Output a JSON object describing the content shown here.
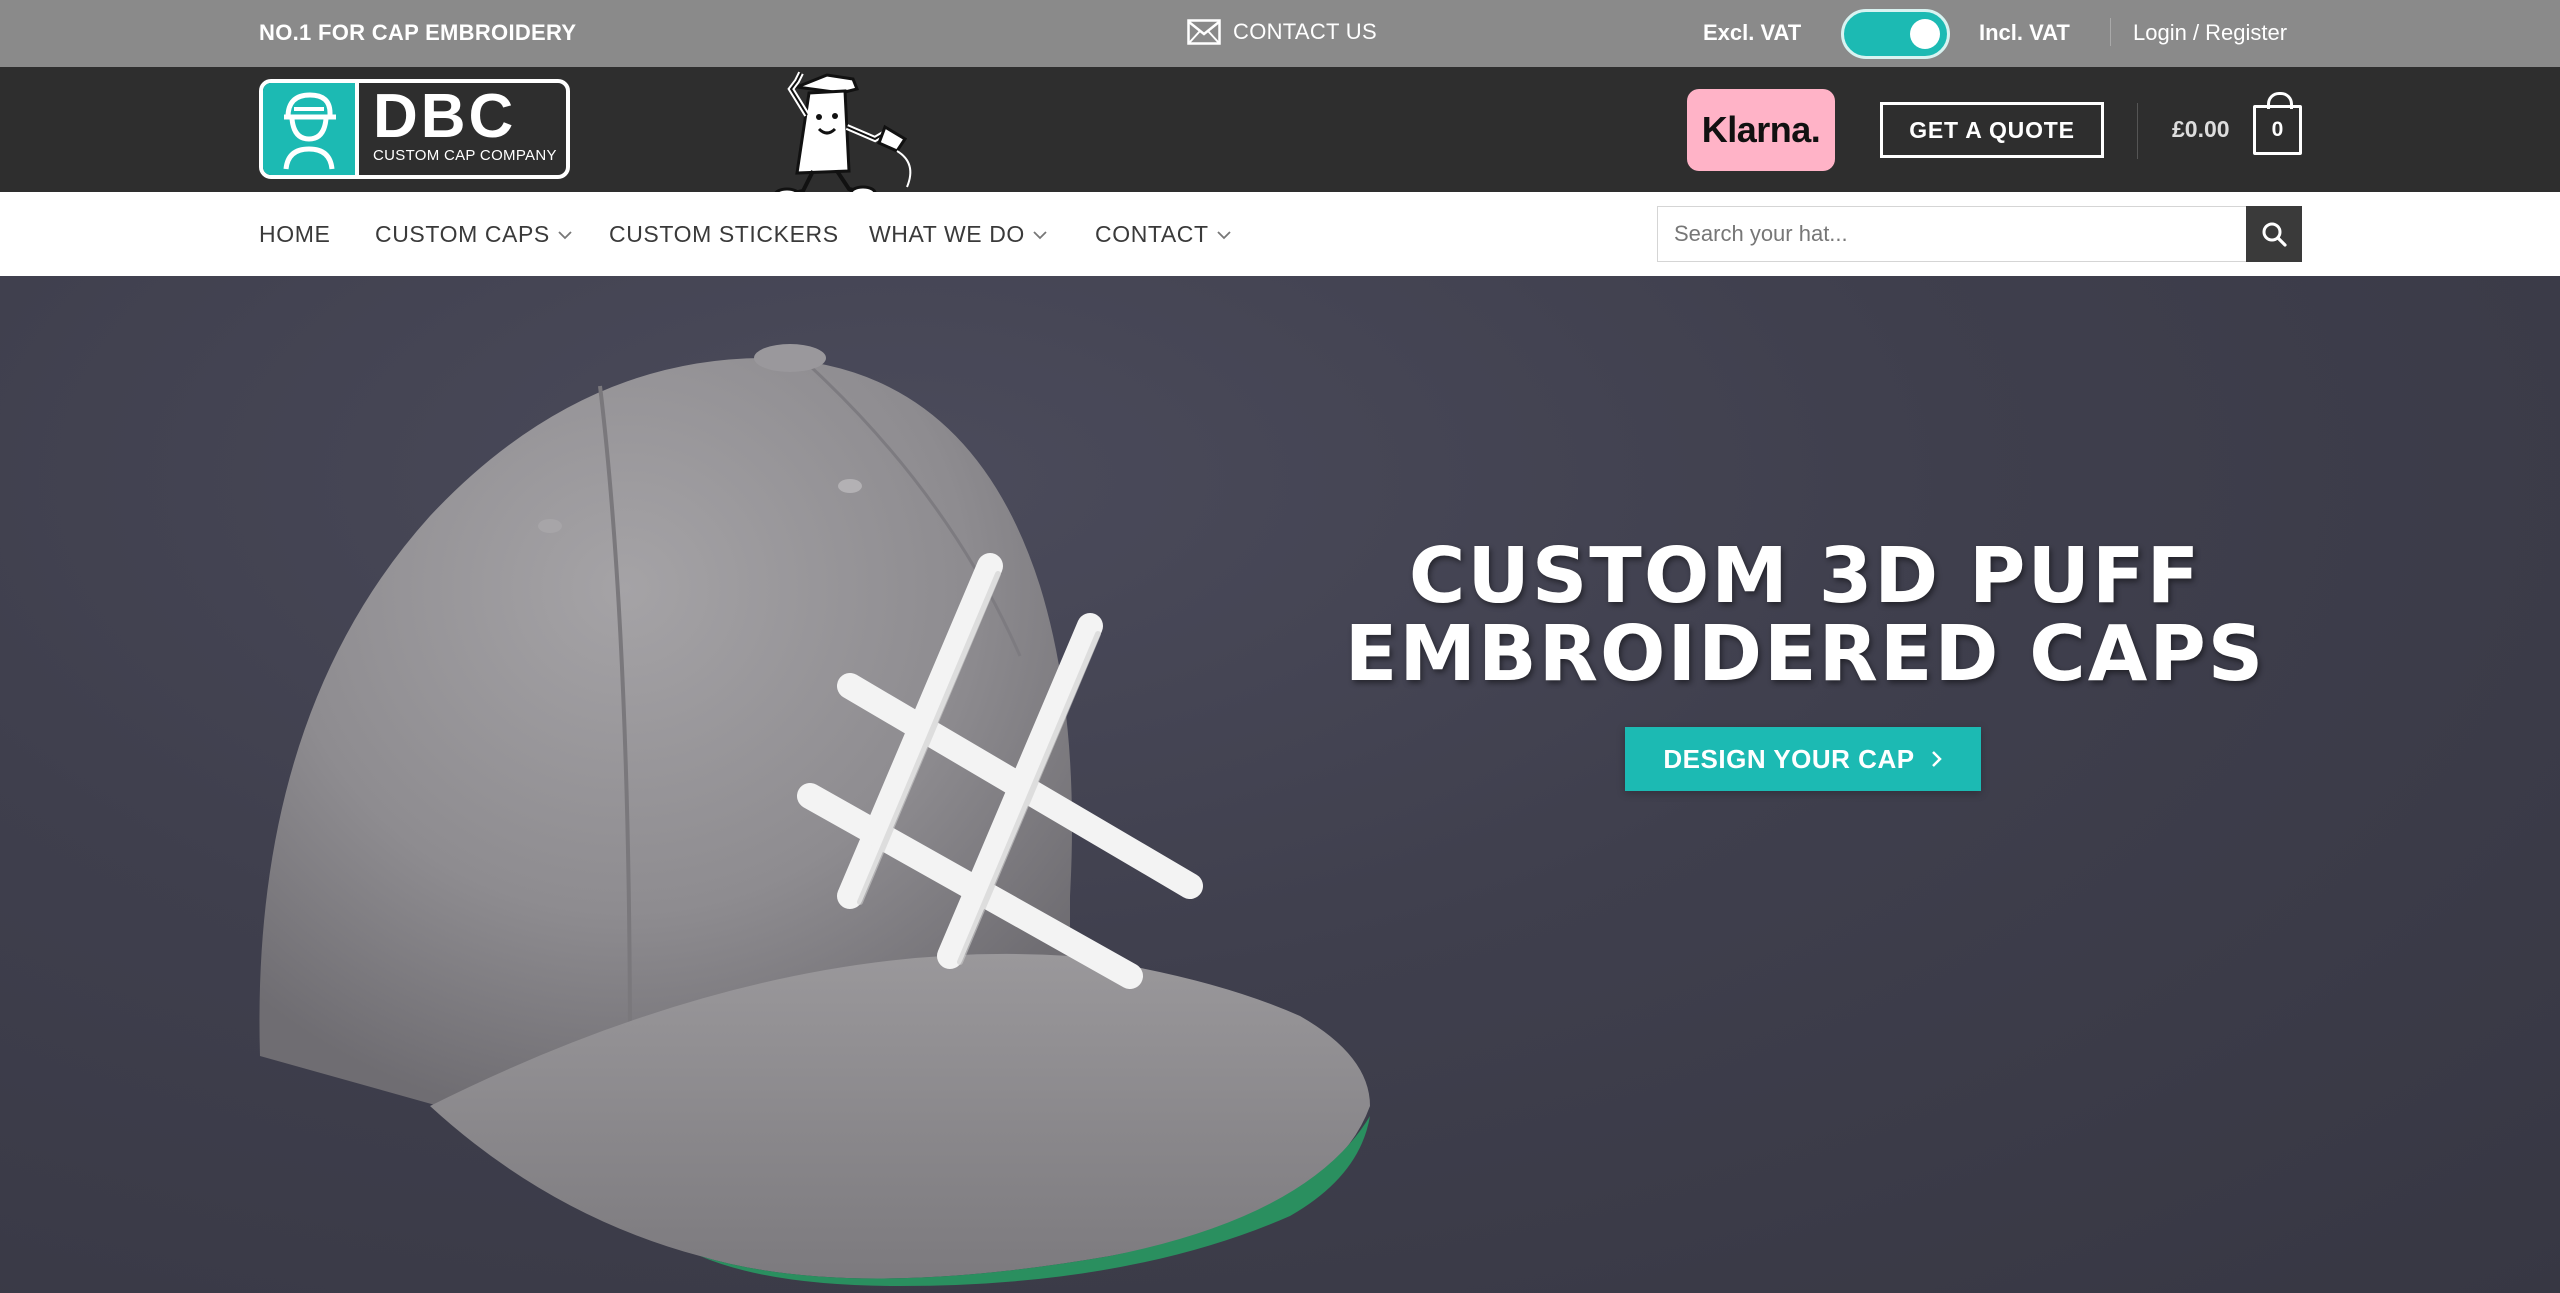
{
  "topbar": {
    "tagline": "NO.1 FOR CAP EMBROIDERY",
    "contact_label": "CONTACT US",
    "vat_excl_label": "Excl. VAT",
    "vat_incl_label": "Incl. VAT",
    "vat_incl_enabled": true,
    "login_label": "Login / Register"
  },
  "header": {
    "logo_brand": "DBC",
    "logo_subtitle": "CUSTOM CAP COMPANY",
    "klarna_label": "Klarna.",
    "quote_label": "GET A QUOTE",
    "cart_total": "£0.00",
    "cart_count": "0"
  },
  "nav": {
    "items": [
      {
        "label": "HOME",
        "has_dropdown": false
      },
      {
        "label": "CUSTOM CAPS",
        "has_dropdown": true
      },
      {
        "label": "CUSTOM STICKERS",
        "has_dropdown": false
      },
      {
        "label": "WHAT WE DO",
        "has_dropdown": true
      },
      {
        "label": "CONTACT",
        "has_dropdown": true
      }
    ],
    "search_placeholder": "Search your hat..."
  },
  "hero": {
    "title_line1": "CUSTOM 3D PUFF",
    "title_line2": "EMBROIDERED CAPS",
    "cta_label": "DESIGN YOUR CAP"
  },
  "colors": {
    "topbar_bg": "#8a8a8a",
    "header_bg": "#2e2e2e",
    "accent_teal": "#1cbab3",
    "klarna_pink": "#ffb3c7",
    "hero_bg": "#3e3e4c",
    "nav_text": "#3a3a3a"
  },
  "icons": [
    "envelope-icon",
    "toggle-switch",
    "cart-icon",
    "chevron-down-icon",
    "search-icon",
    "chevron-right-icon"
  ]
}
